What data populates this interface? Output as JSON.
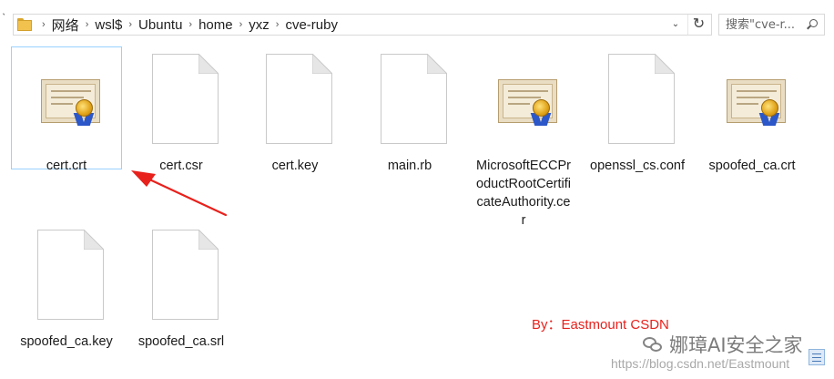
{
  "address_bar": {
    "crumbs": [
      "网络",
      "wsl$",
      "Ubuntu",
      "home",
      "yxz",
      "cve-ruby"
    ],
    "separator": "›"
  },
  "search": {
    "placeholder": "搜索\"cve-r..."
  },
  "files": [
    {
      "name": "cert.crt",
      "icon": "certificate-icon",
      "selected": true
    },
    {
      "name": "cert.csr",
      "icon": "blank-document-icon"
    },
    {
      "name": "cert.key",
      "icon": "blank-document-icon"
    },
    {
      "name": "main.rb",
      "icon": "blank-document-icon"
    },
    {
      "name": "MicrosoftECCProductRootCertificateAuthority.cer",
      "icon": "certificate-icon"
    },
    {
      "name": "openssl_cs.conf",
      "icon": "blank-document-icon"
    },
    {
      "name": "spoofed_ca.crt",
      "icon": "certificate-icon"
    },
    {
      "name": "spoofed_ca.key",
      "icon": "blank-document-icon"
    },
    {
      "name": "spoofed_ca.srl",
      "icon": "blank-document-icon"
    }
  ],
  "annotation": {
    "byline": "By：Eastmount CSDN",
    "color": "#e8211c"
  },
  "watermark": {
    "brand": "娜璋AI安全之家",
    "url": "https://blog.csdn.net/Eastmount"
  }
}
